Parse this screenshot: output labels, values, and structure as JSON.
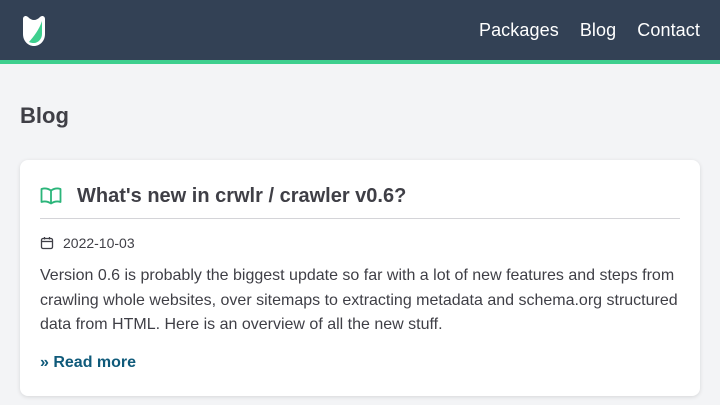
{
  "colors": {
    "header_bg": "#334155",
    "accent": "#3ecf8e",
    "link": "#0f5a7a",
    "page_bg": "#f3f4f6"
  },
  "header": {
    "logo_icon": "crwlr-shield-logo",
    "nav": [
      {
        "label": "Packages"
      },
      {
        "label": "Blog"
      },
      {
        "label": "Contact"
      }
    ]
  },
  "main": {
    "page_title": "Blog",
    "posts": [
      {
        "icon": "book-open-icon",
        "title": "What's new in crwlr / crawler v0.6?",
        "date_icon": "calendar-icon",
        "date": "2022-10-03",
        "excerpt": "Version 0.6 is probably the biggest update so far with a lot of new features and steps from crawling whole websites, over sitemaps to extracting metadata and schema.org structured data from HTML. Here is an overview of all the new stuff.",
        "read_more": "» Read more"
      }
    ]
  }
}
